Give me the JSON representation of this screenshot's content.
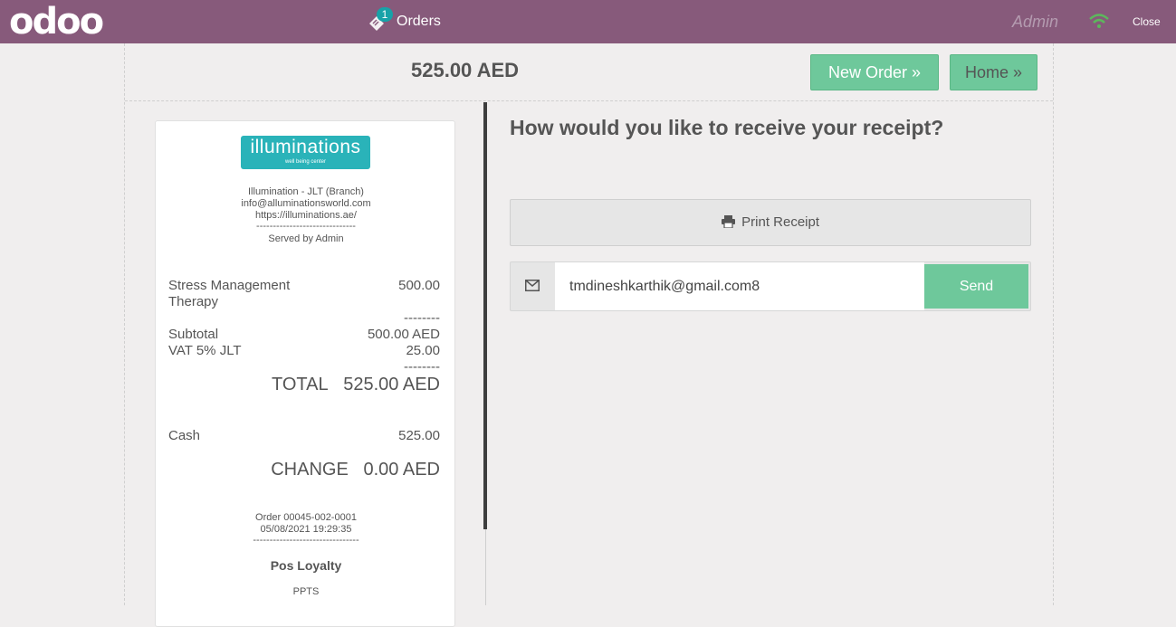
{
  "topbar": {
    "logo": "odoo",
    "orders_badge": "1",
    "orders_label": "Orders",
    "user": "Admin",
    "close_label": "Close",
    "colors": {
      "bar": "#875a7b",
      "wifi": "#5cb85c"
    }
  },
  "header": {
    "total": "525.00 AED",
    "new_order_label": "New Order »",
    "home_label": "Home »"
  },
  "receipt": {
    "logo_text": "illuminations",
    "logo_subtext": "well being center",
    "company": "Illumination - JLT (Branch)",
    "email": "info@alluminationsworld.com",
    "website": "https://illuminations.ae/",
    "separator": "------------------------------",
    "served_by": "Served by Admin",
    "lines": [
      {
        "name_line1": "Stress Management",
        "name_line2": "Therapy",
        "amount": "500.00"
      }
    ],
    "dashes": "--------",
    "subtotal_label": "Subtotal",
    "subtotal_value": "500.00 AED",
    "tax_label": "VAT 5% JLT",
    "tax_value": "25.00",
    "total_label": "TOTAL",
    "total_value": "525.00 AED",
    "payment_label": "Cash",
    "payment_value": "525.00",
    "change_label": "CHANGE",
    "change_value": "0.00 AED",
    "order_ref": "Order 00045-002-0001",
    "datetime": "05/08/2021 19:29:35",
    "separator2": "--------------------------------",
    "loyalty": "Pos Loyalty",
    "ppts": "PPTS"
  },
  "receipt_options": {
    "question": "How would you like to receive your receipt?",
    "print_label": "Print Receipt",
    "email_value": "tmdineshkarthik@gmail.com8",
    "send_label": "Send"
  }
}
